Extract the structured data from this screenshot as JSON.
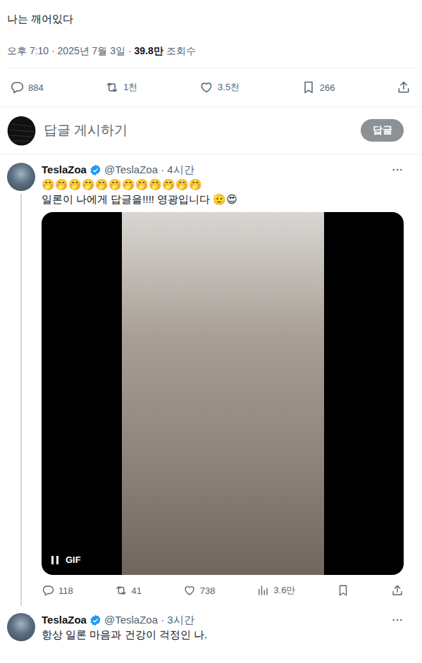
{
  "post": {
    "text": "나는 깨어있다",
    "meta": [
      {
        "text": "오후 7:10 · 2025년 7월 3일 · ",
        "bold": false
      },
      {
        "text": "39.8만",
        "bold": true
      },
      {
        "text": " 조회수",
        "bold": false
      }
    ],
    "actions": [
      {
        "kind": "reply",
        "count": "884"
      },
      {
        "kind": "retweet",
        "count": "1천"
      },
      {
        "kind": "like",
        "count": "3.5천"
      },
      {
        "kind": "bookmark",
        "count": "266"
      },
      {
        "kind": "share",
        "count": ""
      }
    ]
  },
  "composer": {
    "placeholder": "답글 게시하기",
    "button": "답글",
    "disabled": true
  },
  "replies": [
    {
      "name": "TeslaZoa",
      "handle": "@TeslaZoa · 4시간",
      "thread": true,
      "text": [
        "🤭🤭🤭🤭🤭🤭🤭🤭🤭🤭🤭🤭",
        "일론이 나에게 답글을!!!! 영광입니다 🫡😍"
      ],
      "media": {
        "label": "GIF"
      },
      "actions": [
        {
          "kind": "reply",
          "count": "118"
        },
        {
          "kind": "retweet",
          "count": "41"
        },
        {
          "kind": "like",
          "count": "738"
        },
        {
          "kind": "views",
          "count": "3.6만"
        },
        {
          "kind": "bookmark",
          "count": ""
        },
        {
          "kind": "share",
          "count": ""
        }
      ]
    },
    {
      "name": "TeslaZoa",
      "handle": "@TeslaZoa · 3시간",
      "thread": false,
      "text": [
        "항상 일론 마음과 건강이 걱정인 나."
      ]
    }
  ]
}
